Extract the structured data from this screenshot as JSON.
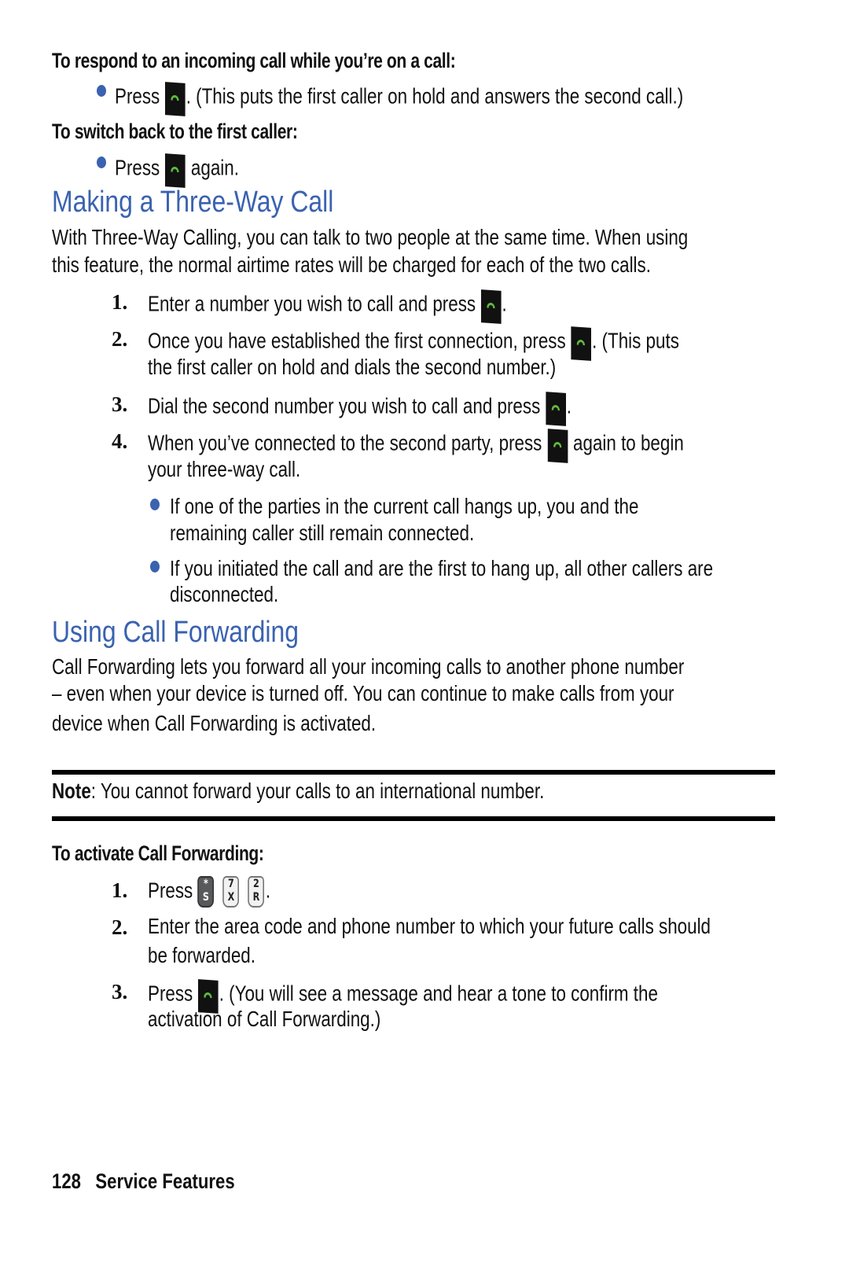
{
  "colors": {
    "heading": "#3a62b0",
    "bullet": "#3a62b0",
    "talk_key_bg": "#111111",
    "talk_key_icon": "#5fb83d"
  },
  "respond": {
    "heading": "To respond to an incoming call while you’re on a call:",
    "bullet": {
      "before": "Press",
      "icon": "talk-key-icon",
      "after": ". (This puts the first caller on hold and answers the second call.)"
    }
  },
  "switch_back": {
    "heading": "To switch back to the first caller:",
    "bullet": {
      "before": "Press",
      "icon": "talk-key-icon",
      "after": "again."
    }
  },
  "three_way": {
    "title": "Making a Three-Way Call",
    "intro": [
      "With Three-Way Calling, you can talk to two people at the same time. When using",
      "this feature, the normal airtime rates will be charged for each of the two calls."
    ],
    "steps": [
      {
        "num": "1.",
        "before": "Enter a number you wish to call and press",
        "after": "."
      },
      {
        "num": "2.",
        "before": "Once you have established the first connection, press",
        "after": ". (This puts",
        "line2": "the first caller on hold and dials the second number.)"
      },
      {
        "num": "3.",
        "before": "Dial the second number you wish to call and press",
        "after": "."
      },
      {
        "num": "4.",
        "before": "When you’ve connected to the second party, press",
        "after": "again to begin",
        "line2": "your three-way call."
      }
    ],
    "notes": [
      {
        "line1": "If one of the parties in the current call hangs up, you and the",
        "line2": "remaining caller still remain connected."
      },
      {
        "line1": "If you initiated the call and are the first to hang up, all other callers are",
        "line2": "disconnected."
      }
    ]
  },
  "forwarding": {
    "title": "Using Call Forwarding",
    "intro": [
      "Call Forwarding lets you forward all your incoming calls to another phone number",
      "– even when your device is turned off. You can continue to make calls from your",
      "device when Call Forwarding is activated."
    ],
    "note": {
      "label": "Note",
      "text": ": You cannot forward your calls to an international number."
    },
    "activate_heading": "To activate Call Forwarding:",
    "steps": [
      {
        "num": "1.",
        "before": "Press",
        "keys": [
          {
            "top": "*",
            "bottom": "S",
            "style": "dark"
          },
          {
            "top": "7",
            "bottom": "X",
            "style": "light"
          },
          {
            "top": "2",
            "bottom": "R",
            "style": "light"
          }
        ],
        "after": "."
      },
      {
        "num": "2.",
        "line1": "Enter the area code and phone number to which your future calls should",
        "line2": "be forwarded."
      },
      {
        "num": "3.",
        "before": "Press",
        "after": ". (You will see a message and hear a tone to confirm the",
        "line2": "activation of Call Forwarding.)"
      }
    ]
  },
  "footer": {
    "page_number": "128",
    "section": "Service Features"
  }
}
